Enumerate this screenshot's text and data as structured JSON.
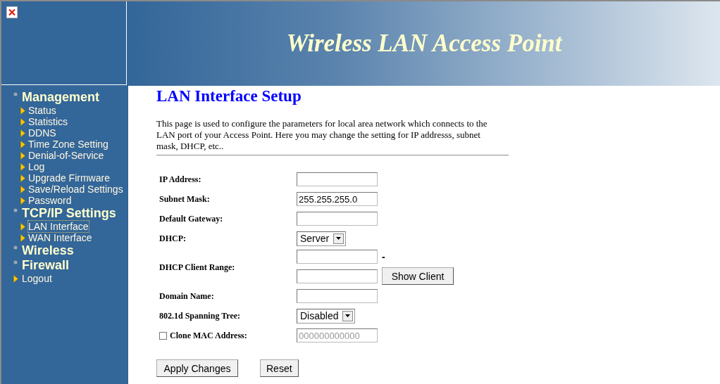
{
  "header": {
    "title": "Wireless LAN Access Point"
  },
  "sidebar": {
    "items": [
      {
        "kind": "category",
        "label": "Management",
        "children": [
          {
            "label": "Status",
            "selected": false
          },
          {
            "label": "Statistics",
            "selected": false
          },
          {
            "label": "DDNS",
            "selected": false
          },
          {
            "label": "Time Zone Setting",
            "selected": false
          },
          {
            "label": "Denial-of-Service",
            "selected": false
          },
          {
            "label": "Log",
            "selected": false
          },
          {
            "label": "Upgrade Firmware",
            "selected": false
          },
          {
            "label": "Save/Reload Settings",
            "selected": false
          },
          {
            "label": "Password",
            "selected": false
          }
        ]
      },
      {
        "kind": "category",
        "label": "TCP/IP Settings",
        "children": [
          {
            "label": "LAN Interface",
            "selected": true
          },
          {
            "label": "WAN Interface",
            "selected": false
          }
        ]
      },
      {
        "kind": "category",
        "label": "Wireless"
      },
      {
        "kind": "category",
        "label": "Firewall"
      },
      {
        "kind": "link",
        "label": "Logout",
        "selected": false
      }
    ]
  },
  "page": {
    "title": "LAN Interface Setup",
    "description": "This page is used to configure the parameters for local area network which connects to the LAN port of your Access Point. Here you may change the setting for IP addresss, subnet mask, DHCP, etc.."
  },
  "form": {
    "rows": [
      {
        "kind": "text",
        "label": "IP Address:"
      },
      {
        "kind": "text",
        "label": "Subnet Mask:",
        "value": "255.255.255.0"
      },
      {
        "kind": "text",
        "label": "Default Gateway:"
      },
      {
        "kind": "select",
        "label": "DHCP:",
        "value": "Server"
      },
      {
        "kind": "range",
        "label": "DHCP Client Range:",
        "separator": "-",
        "button": "Show Client"
      },
      {
        "kind": "text",
        "label": "Domain Name:"
      },
      {
        "kind": "select",
        "label": "802.1d Spanning Tree:",
        "value": "Disabled"
      },
      {
        "kind": "checkbox",
        "label": "Clone MAC Address:",
        "checked": false,
        "value": "000000000000",
        "disabled": true
      }
    ],
    "buttons": [
      "Apply Changes",
      "Reset"
    ]
  }
}
